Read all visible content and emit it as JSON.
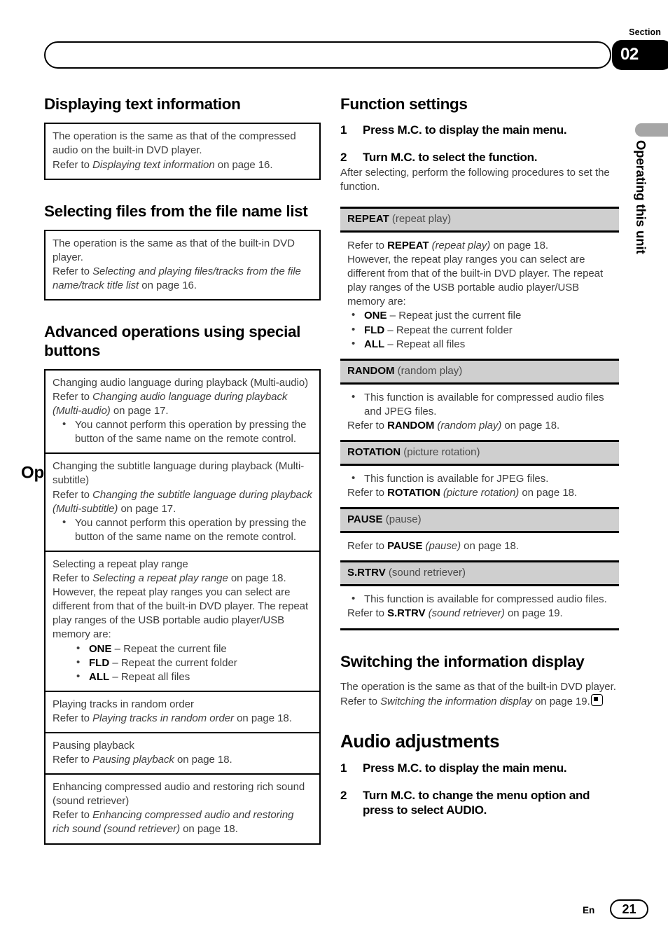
{
  "header": {
    "section_label": "Section",
    "running_title": "Operating this unit",
    "section_number": "02",
    "margin_tab_title": "Operating this unit"
  },
  "footer": {
    "language": "En",
    "page_number": "21"
  },
  "left_column": {
    "section1": {
      "title": "Displaying text information",
      "box": {
        "line1": "The operation is the same as that of the compressed audio on the built-in DVD player.",
        "refer_prefix": "Refer to ",
        "refer_italic": "Displaying text information",
        "refer_suffix": " on page 16."
      }
    },
    "section2": {
      "title": "Selecting files from the file name list",
      "box": {
        "line1": "The operation is the same as that of the built-in DVD player.",
        "refer_prefix": "Refer to ",
        "refer_italic": "Selecting and playing files/tracks from the file name/track title list",
        "refer_suffix": " on page 16."
      }
    },
    "section3": {
      "title": "Advanced operations using special buttons",
      "rows": [
        {
          "heading": "Changing audio language during playback (Multi-audio)",
          "refer_prefix": "Refer to ",
          "refer_italic": "Changing audio language during playback (Multi-audio)",
          "refer_suffix": " on page 17.",
          "bullets": [
            "You cannot perform this operation by pressing the button of the same name on the remote control."
          ]
        },
        {
          "heading": "Changing the subtitle language during playback (Multi-subtitle)",
          "refer_prefix": "Refer to ",
          "refer_italic": "Changing the subtitle language during playback (Multi-subtitle)",
          "refer_suffix": " on page 17.",
          "bullets": [
            "You cannot perform this operation by pressing the button of the same name on the remote control."
          ]
        },
        {
          "heading": "Selecting a repeat play range",
          "refer_prefix": "Refer to ",
          "refer_italic": "Selecting a repeat play range",
          "refer_suffix": " on page 18.",
          "extra": "However, the repeat play ranges you can select are different from that of the built-in DVD player. The repeat play ranges of the USB portable audio player/USB memory are:",
          "range_bullets": [
            {
              "code": "ONE",
              "desc": " – Repeat the current file"
            },
            {
              "code": "FLD",
              "desc": " – Repeat the current folder"
            },
            {
              "code": "ALL",
              "desc": " – Repeat all files"
            }
          ]
        },
        {
          "heading": "Playing tracks in random order",
          "refer_prefix": "Refer to ",
          "refer_italic": "Playing tracks in random order",
          "refer_suffix": " on page 18."
        },
        {
          "heading": "Pausing playback",
          "refer_prefix": "Refer to ",
          "refer_italic": "Pausing playback",
          "refer_suffix": " on page 18."
        },
        {
          "heading": "Enhancing compressed audio and restoring rich sound (sound retriever)",
          "refer_prefix": "Refer to ",
          "refer_italic": "Enhancing compressed audio and restoring rich sound (sound retriever)",
          "refer_suffix": " on page 18."
        }
      ]
    }
  },
  "right_column": {
    "function_settings": {
      "title": "Function settings",
      "steps": [
        {
          "num": "1",
          "text": "Press M.C. to display the main menu."
        },
        {
          "num": "2",
          "text": "Turn M.C. to select the function."
        }
      ],
      "after_step_text": "After selecting, perform the following procedures to set the function.",
      "entries": [
        {
          "code": "REPEAT",
          "name": " (repeat play)",
          "refer_prefix": "Refer to ",
          "refer_bold": "REPEAT",
          "refer_italic": " (repeat play)",
          "refer_suffix": " on page 18.",
          "extra": "However, the repeat play ranges you can select are different from that of the built-in DVD player. The repeat play ranges of the USB portable audio player/USB memory are:",
          "range_bullets": [
            {
              "code": "ONE",
              "desc": " – Repeat just the current file"
            },
            {
              "code": "FLD",
              "desc": " – Repeat the current folder"
            },
            {
              "code": "ALL",
              "desc": " – Repeat all files"
            }
          ]
        },
        {
          "code": "RANDOM",
          "name": " (random play)",
          "bullets": [
            "This function is available for compressed audio files and JPEG files."
          ],
          "refer_prefix": "Refer to ",
          "refer_bold": "RANDOM",
          "refer_italic": " (random play)",
          "refer_suffix": " on page 18."
        },
        {
          "code": "ROTATION",
          "name": " (picture rotation)",
          "bullets": [
            "This function is available for JPEG files."
          ],
          "refer_prefix": "Refer to ",
          "refer_bold": "ROTATION",
          "refer_italic": " (picture rotation)",
          "refer_suffix": " on page 18."
        },
        {
          "code": "PAUSE",
          "name": " (pause)",
          "refer_prefix": "Refer to ",
          "refer_bold": "PAUSE",
          "refer_italic": " (pause)",
          "refer_suffix": " on page 18."
        },
        {
          "code": "S.RTRV",
          "name": " (sound retriever)",
          "bullets": [
            "This function is available for compressed audio files."
          ],
          "refer_prefix": "Refer to ",
          "refer_bold": "S.RTRV",
          "refer_italic": " (sound retriever)",
          "refer_suffix": " on page 19."
        }
      ]
    },
    "switching_display": {
      "title": "Switching the information display",
      "line1": "The operation is the same as that of the built-in DVD player.",
      "refer_prefix": "Refer to ",
      "refer_italic": "Switching the information display",
      "refer_suffix": " on page 19.",
      "end_marker": "end-of-section-marker"
    },
    "audio_adjustments": {
      "title": "Audio adjustments",
      "steps": [
        {
          "num": "1",
          "text": "Press M.C. to display the main menu."
        },
        {
          "num": "2",
          "text": "Turn M.C. to change the menu option and press to select AUDIO."
        }
      ]
    }
  }
}
